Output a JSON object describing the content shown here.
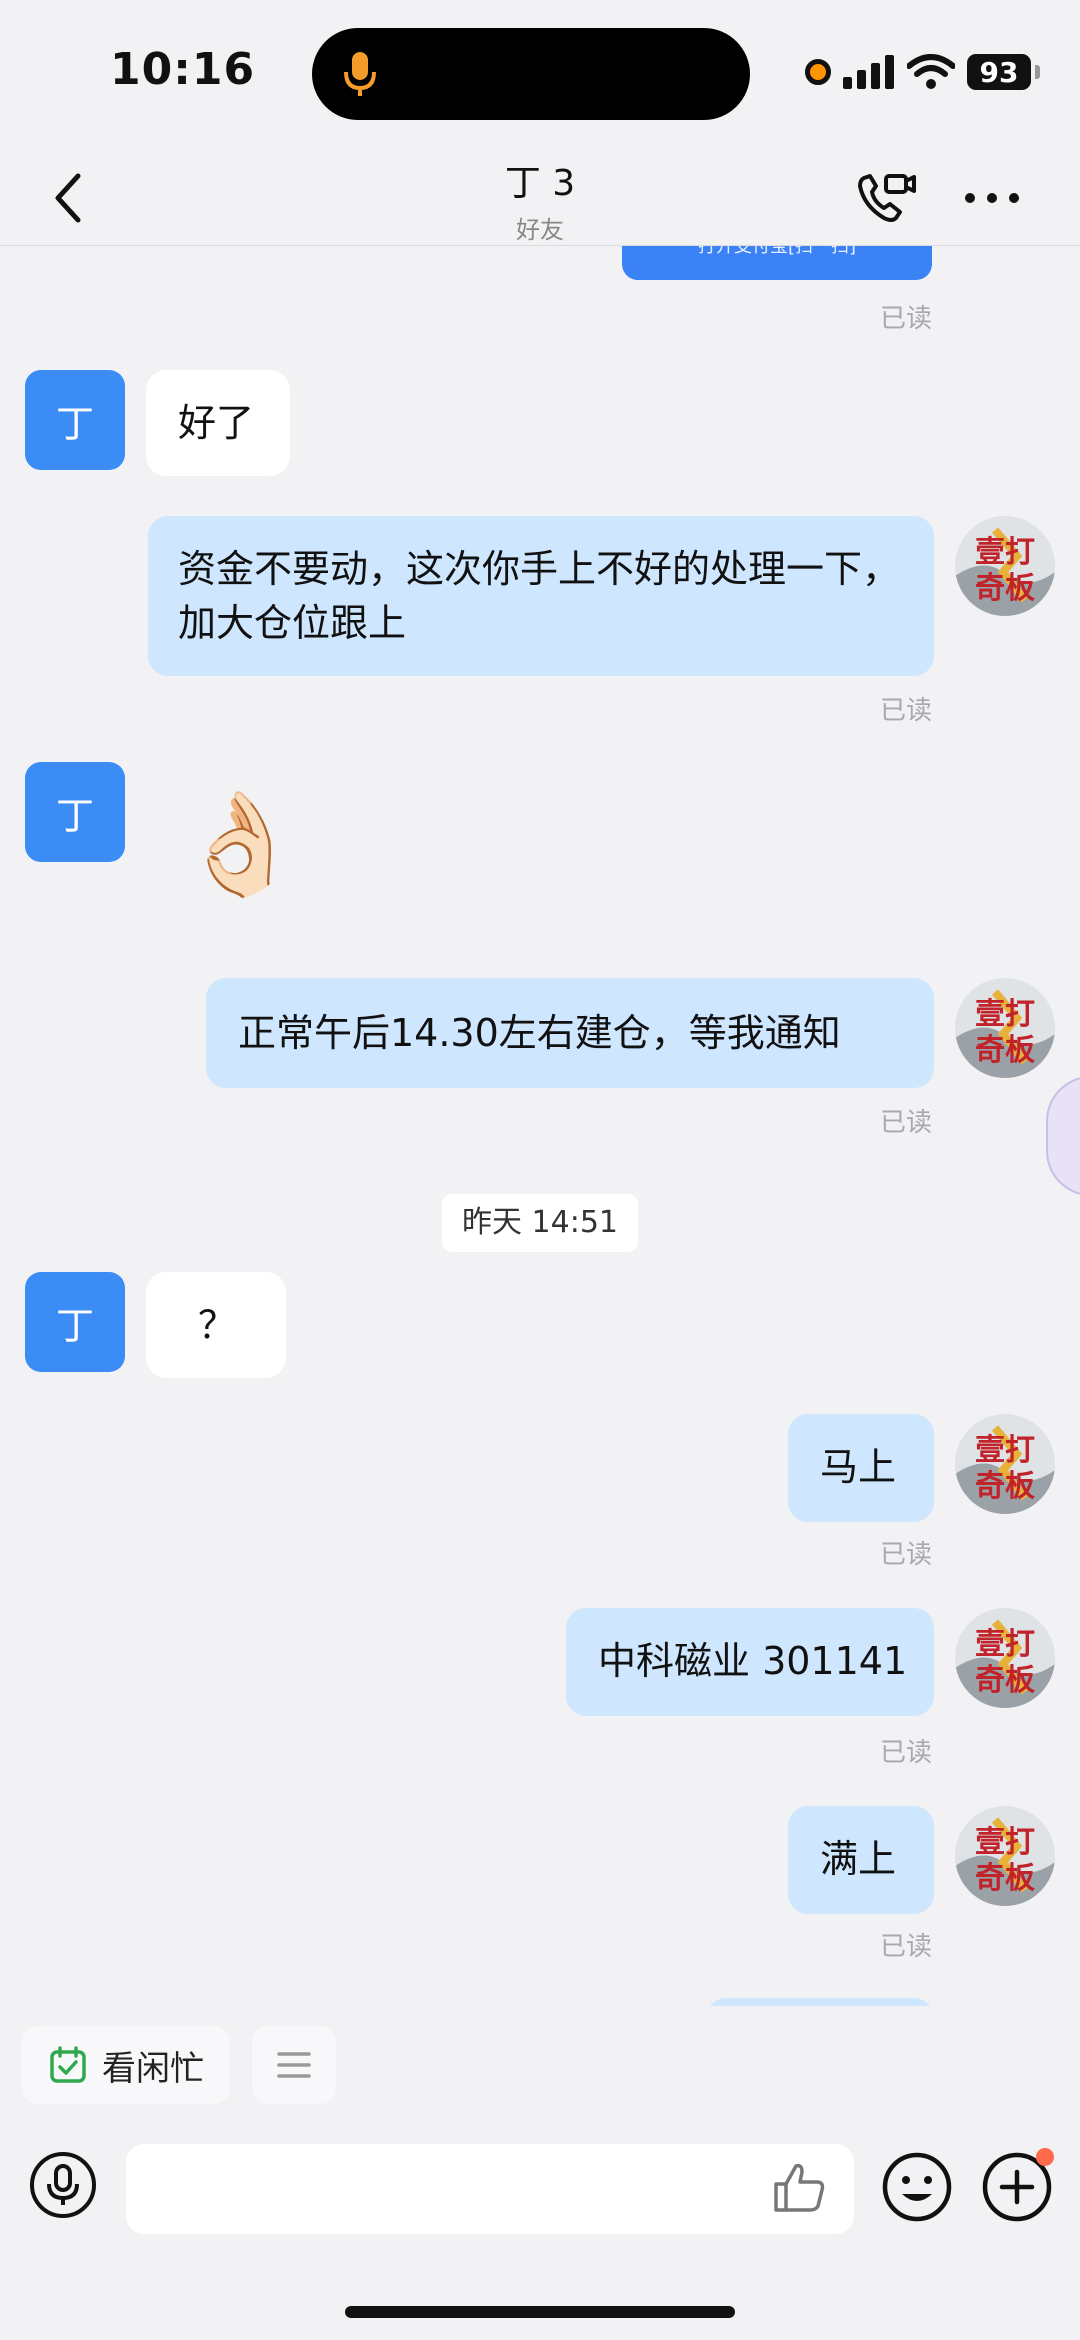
{
  "status_bar": {
    "time": "10:16",
    "battery": "93"
  },
  "header": {
    "title": "丁 3",
    "subtitle": "好友"
  },
  "contact": {
    "avatar_char": "丁"
  },
  "pay_card_text": "打开支付宝[扫一扫]",
  "read_label": "已读",
  "timestamp": "昨天 14:51",
  "messages": [
    {
      "from": "them",
      "text": "好了"
    },
    {
      "from": "me",
      "text": "资金不要动，这次你手上不好的处理一下，加大仓位跟上"
    },
    {
      "from": "them",
      "text": "👌🏻"
    },
    {
      "from": "me",
      "text": "正常午后14.30左右建仓，等我通知"
    },
    {
      "from": "them",
      "text": "？"
    },
    {
      "from": "me",
      "text": "马上"
    },
    {
      "from": "me",
      "text": "中科磁业 301141"
    },
    {
      "from": "me",
      "text": "满上"
    }
  ],
  "my_avatar_text": "壹打 奇板",
  "quick_actions": {
    "busy_label": "看闲忙"
  },
  "input": {
    "placeholder": ""
  },
  "colors": {
    "accent": "#3b8cf5",
    "my_bubble": "#cfe6ff",
    "background": "#f2f2f4"
  }
}
